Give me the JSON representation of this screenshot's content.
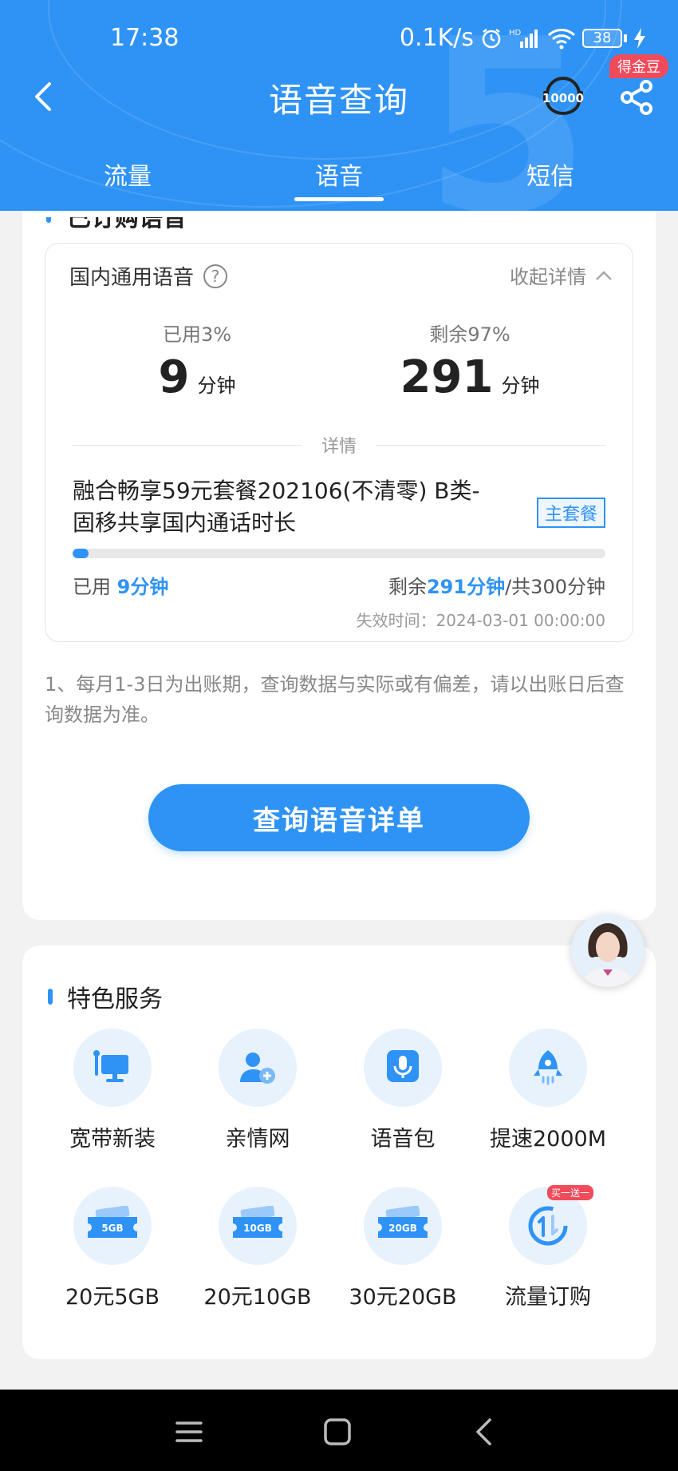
{
  "status_bar": {
    "time": "17:38",
    "network_speed": "0.1K/s",
    "signal_label": "HD",
    "battery": "38"
  },
  "header": {
    "title": "语音查询",
    "back_icon": "chevron-left-icon",
    "hotline_icon": "10000-hotline-icon",
    "share_icon": "share-icon",
    "coin_badge": "得金豆"
  },
  "tabs": [
    {
      "label": "流量",
      "active": false
    },
    {
      "label": "语音",
      "active": true
    },
    {
      "label": "短信",
      "active": false
    }
  ],
  "purchased_section": {
    "title": "已订购语音"
  },
  "voice_card": {
    "title": "国内通用语音",
    "collapse_label": "收起详情",
    "used_label": "已用3%",
    "used_value": "9",
    "used_unit": "分钟",
    "remain_label": "剩余97%",
    "remain_value": "291",
    "remain_unit": "分钟",
    "detail_label": "详情",
    "package_name": "融合畅享59元套餐202106(不清零) B类-固移共享国内通话时长",
    "package_tag": "主套餐",
    "usage_fraction": 0.03,
    "used_prefix": "已用 ",
    "used_amount": "9分钟",
    "remain_prefix": "剩余",
    "remain_amount": "291分钟",
    "total_suffix": "/共300分钟",
    "expire_text": "失效时间：2024-03-01 00:00:00"
  },
  "note": "1、每月1-3日为出账期，查询数据与实际或有偏差，请以出账日后查询数据为准。",
  "query_button": "查询语音详单",
  "feature_section": {
    "title": "特色服务",
    "items": [
      {
        "label": "宽带新装",
        "icon": "broadband-icon"
      },
      {
        "label": "亲情网",
        "icon": "add-user-icon"
      },
      {
        "label": "语音包",
        "icon": "microphone-icon"
      },
      {
        "label": "提速2000M",
        "icon": "rocket-icon"
      },
      {
        "label": "20元5GB",
        "icon": "ticket-icon",
        "ticket": "5GB"
      },
      {
        "label": "20元10GB",
        "icon": "ticket-icon",
        "ticket": "10GB"
      },
      {
        "label": "30元20GB",
        "icon": "ticket-icon",
        "ticket": "20GB"
      },
      {
        "label": "流量订购",
        "icon": "data-order-icon",
        "badge": "买一送一"
      }
    ]
  },
  "colors": {
    "primary": "#2f93f5",
    "badge_red": "#f04b5b"
  }
}
